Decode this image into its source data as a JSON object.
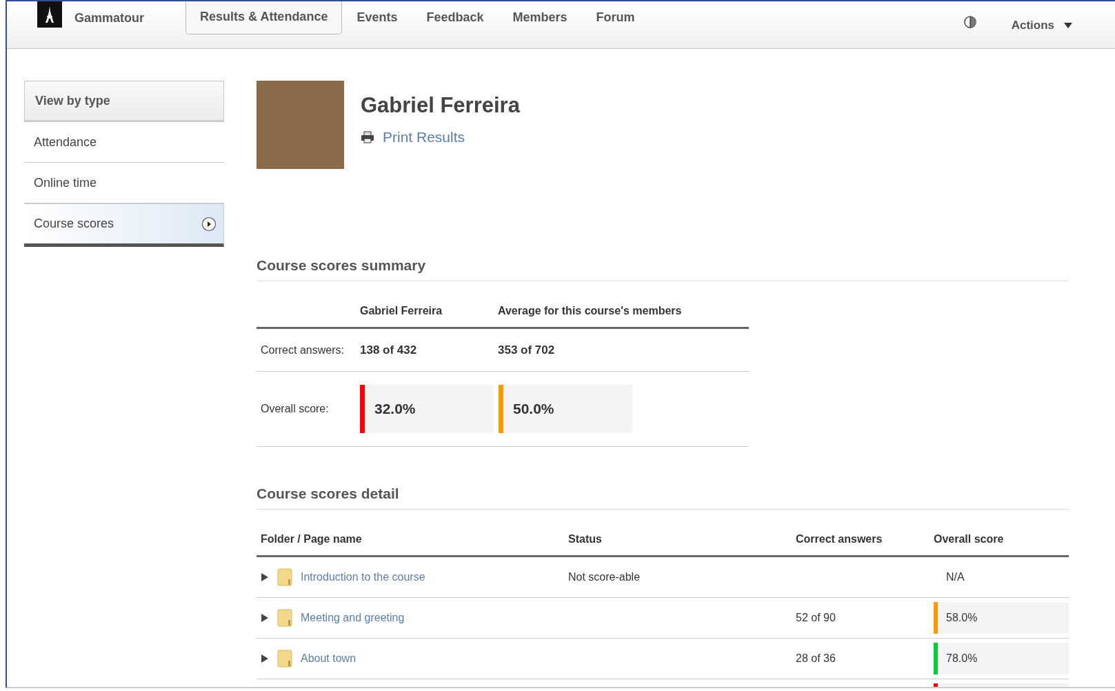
{
  "nav": {
    "brand": "Gammatour",
    "tabs": [
      {
        "label": "Results & Attendance",
        "selected": true
      },
      {
        "label": "Events",
        "selected": false
      },
      {
        "label": "Feedback",
        "selected": false
      },
      {
        "label": "Members",
        "selected": false
      },
      {
        "label": "Forum",
        "selected": false
      }
    ],
    "actions": "Actions"
  },
  "sidebar": {
    "heading": "View by type",
    "items": [
      {
        "label": "Attendance",
        "selected": false
      },
      {
        "label": "Online time",
        "selected": false
      },
      {
        "label": "Course scores",
        "selected": true
      }
    ]
  },
  "profile": {
    "name": "Gabriel Ferreira",
    "print_link": "Print Results"
  },
  "summary": {
    "title": "Course scores summary",
    "columns": [
      "Gabriel Ferreira",
      "Average for this course's members"
    ],
    "correct_label": "Correct answers:",
    "correct": [
      "138 of 432",
      "353 of 702"
    ],
    "score_label": "Overall score:",
    "scores": [
      {
        "value": "32.0%",
        "color": "#ff0000"
      },
      {
        "value": "50.0%",
        "color": "#ff9900"
      }
    ]
  },
  "detail": {
    "title": "Course scores detail",
    "columns": [
      "Folder / Page name",
      "Status",
      "Correct answers",
      "Overall score"
    ],
    "rows": [
      {
        "name": "Introduction to the course",
        "status": "Not score-able",
        "correct": "",
        "score": "N/A",
        "kind": "plain"
      },
      {
        "name": "Meeting and greeting",
        "status": "",
        "correct": "52 of 90",
        "score": "58.0%",
        "kind": "bar",
        "color": "#ff9900"
      },
      {
        "name": "About town",
        "status": "",
        "correct": "28 of 36",
        "score": "78.0%",
        "kind": "bar",
        "color": "#00cc33"
      },
      {
        "kind": "bar",
        "color": "#ff0000"
      }
    ]
  }
}
